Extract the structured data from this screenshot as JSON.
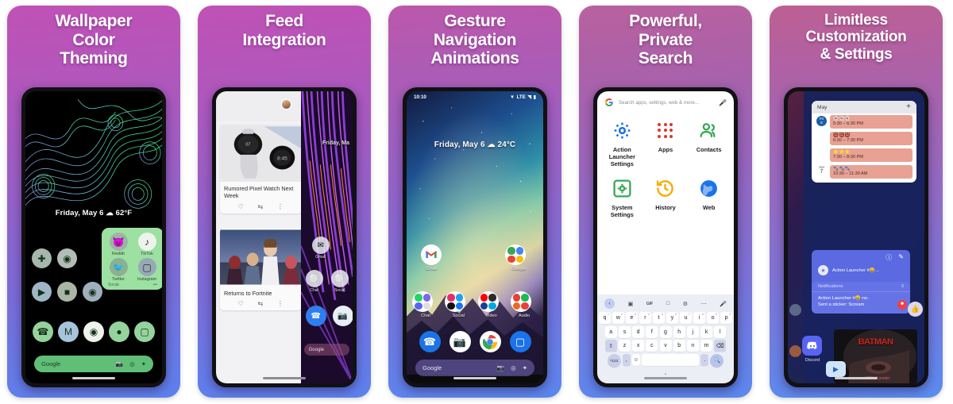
{
  "panels": [
    {
      "id": "wallpaper-color-theming",
      "headline": "Wallpaper Color Theming",
      "headline_lines": [
        "Wallpaper",
        "Color",
        "Theming"
      ],
      "phone": {
        "date_weather": "Friday, May 6  ☁ 62°F",
        "folder": {
          "name": "Social",
          "overflow": "•••",
          "apps": [
            {
              "label": "Reddit",
              "icon": "reddit-icon"
            },
            {
              "label": "TikTok",
              "icon": "tiktok-icon"
            },
            {
              "label": "Twitter",
              "icon": "twitter-icon"
            },
            {
              "label": "Instagram",
              "icon": "instagram-icon"
            }
          ]
        },
        "row_icons": [
          "plus-icon",
          "camera-icon"
        ],
        "row2_icons": [
          "play-store-icon",
          "chat-bubble-icon",
          "muted-icon"
        ],
        "dock_icons": [
          "phone-icon",
          "gmail-icon",
          "chrome-icon",
          "maps-icon",
          "messages-icon"
        ],
        "search": {
          "label": "Google",
          "icons": [
            "camera-icon",
            "lens-icon",
            "assistant-icon"
          ]
        }
      }
    },
    {
      "id": "feed-integration",
      "headline": "Feed Integration",
      "headline_lines": [
        "Feed",
        "Integration"
      ],
      "phone": {
        "feed_cards": [
          {
            "title": "Rumored Pixel Watch Next Week",
            "actions": [
              "heart-icon",
              "share-icon",
              "more-icon"
            ]
          },
          {
            "title": "Returns to Fortnite",
            "actions": [
              "heart-icon",
              "share-icon",
              "more-icon"
            ]
          }
        ],
        "right_date": "Friday, Ma",
        "right_folders": [
          {
            "label": "Gmail"
          },
          {
            "label": "Chat"
          },
          {
            "label": "Social"
          }
        ],
        "search": {
          "label": "Google"
        }
      }
    },
    {
      "id": "gesture-navigation-animations",
      "headline": "Gesture Navigation Animations",
      "headline_lines": [
        "Gesture",
        "Navigation",
        "Animations"
      ],
      "phone": {
        "status": {
          "time": "10:10",
          "icons": [
            "wifi-icon",
            "lte-label",
            "signal-icon",
            "battery-icon"
          ],
          "network": "LTE"
        },
        "date_weather": "Friday, May 6  ☁ 24°C",
        "apps_top": [
          {
            "label": "Gmail",
            "icon": "gmail-icon"
          },
          {
            "label": "Google",
            "icon": "google-folder-icon"
          }
        ],
        "folders": [
          {
            "label": "Chat"
          },
          {
            "label": "Social"
          },
          {
            "label": "Video"
          },
          {
            "label": "Audio"
          }
        ],
        "dock_icons": [
          "phone-icon",
          "camera-icon",
          "chrome-icon",
          "messages-icon"
        ],
        "search": {
          "label": "Google",
          "icons": [
            "camera-icon",
            "lens-icon",
            "assistant-icon"
          ]
        }
      }
    },
    {
      "id": "powerful-private-search",
      "headline": "Powerful, Private Search",
      "headline_lines": [
        "Powerful,",
        "Private",
        "Search"
      ],
      "phone": {
        "search_field": {
          "placeholder": "Search apps, settings, web & more...",
          "leading_icon": "google-g-icon",
          "trailing_icon": "mic-icon"
        },
        "shortcuts": [
          {
            "label": "Action Launcher Settings",
            "icon": "gear-icon",
            "color": "#1a73e8"
          },
          {
            "label": "Apps",
            "icon": "apps-dots-icon",
            "color": "#d73a2e"
          },
          {
            "label": "Contacts",
            "icon": "contacts-icon",
            "color": "#34a853"
          },
          {
            "label": "System Settings",
            "icon": "system-settings-icon",
            "color": "#34a853"
          },
          {
            "label": "History",
            "icon": "history-icon",
            "color": "#f9ab00"
          },
          {
            "label": "Web",
            "icon": "globe-icon",
            "color": "#1a73e8"
          }
        ],
        "keyboard": {
          "toolbar": [
            "back-chevron-icon",
            "sticker-icon",
            "GIF",
            "clipboard-icon",
            "gear-icon",
            "more-icon",
            "mic-icon"
          ],
          "row1": [
            "q",
            "w",
            "e",
            "r",
            "t",
            "y",
            "u",
            "i",
            "o",
            "p"
          ],
          "row1_sup": [
            "1",
            "2",
            "3",
            "4",
            "5",
            "6",
            "7",
            "8",
            "9",
            "0"
          ],
          "row2": [
            "a",
            "s",
            "d",
            "f",
            "g",
            "h",
            "j",
            "k",
            "l"
          ],
          "row3": [
            "z",
            "x",
            "c",
            "v",
            "b",
            "n",
            "m"
          ],
          "shift": "shift-icon",
          "backspace": "backspace-icon",
          "symbols": "?123",
          "comma": ",",
          "emoji": "emoji-icon",
          "period": ".",
          "enter": "search-icon",
          "hide": "hide-keyboard-icon"
        }
      }
    },
    {
      "id": "limitless-customization-settings",
      "headline": "Limitless Customization & Settings",
      "headline_lines": [
        "Limitless",
        "Customization",
        "& Settings"
      ],
      "phone": {
        "calendar": {
          "month": "May",
          "add": "+",
          "events": [
            {
              "day_week": "Fri",
              "day_num": "6",
              "emoji": "👻👻👻",
              "time": "5:30 – 6:30 PM"
            },
            {
              "day_week": "",
              "day_num": "",
              "emoji": "👹👹👹",
              "time": "6:30 – 7:30 PM"
            },
            {
              "day_week": "",
              "day_num": "",
              "emoji": "⭐⭐⭐",
              "time": "7:30 – 8:30 PM"
            },
            {
              "day_week": "Sat",
              "day_num": "7",
              "emoji": "🐾🐾🐾",
              "time": "10:30 – 11:30 AM"
            }
          ]
        },
        "discord_card": {
          "actions": [
            "info-icon",
            "edit-icon"
          ],
          "server": "Action Launcher #😀...",
          "notifications_label": "Notifications",
          "notifications_count": "3",
          "message_line1": "Action Launcher #😀-ne.",
          "message_line2": "Sent a sticker: Scream",
          "thumbs_icon": "thumbs-up-icon"
        },
        "app": {
          "label": "Discord",
          "icon": "discord-icon"
        },
        "poster": {
          "title": "BATMAN",
          "caption": "w/ RDMJ poster",
          "play_icon": "play-icon"
        }
      }
    }
  ],
  "theme": {
    "card_top": "#c051b6",
    "card_bottom": "#5c81ee",
    "accent_green": "#9ce0a2",
    "phone_bezel": "#111114",
    "discord_blue": "#5865f2",
    "calendar_event": "#e8a193"
  }
}
